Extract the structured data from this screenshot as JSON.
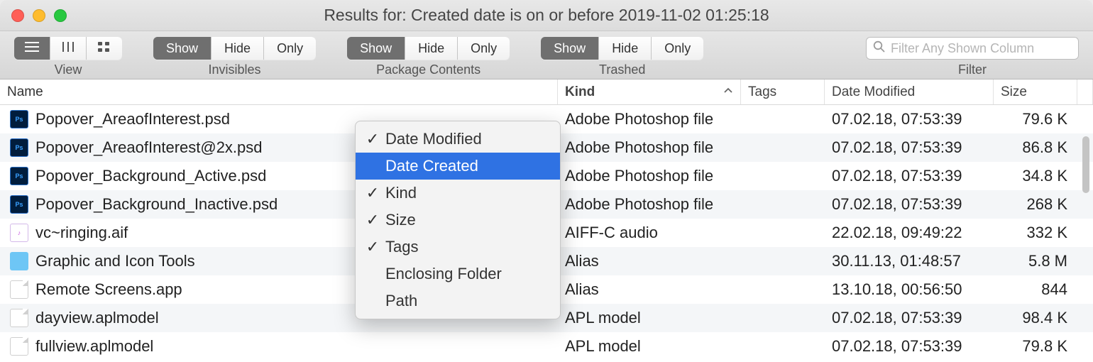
{
  "window": {
    "title": "Results for: Created date is on or before 2019-11-02 01:25:18"
  },
  "toolbar": {
    "view_label": "View",
    "invisibles_label": "Invisibles",
    "package_label": "Package Contents",
    "trashed_label": "Trashed",
    "filter_label": "Filter",
    "show": "Show",
    "hide": "Hide",
    "only": "Only",
    "search_placeholder": "Filter Any Shown Column"
  },
  "columns": {
    "name": "Name",
    "kind": "Kind",
    "tags": "Tags",
    "date": "Date Modified",
    "size": "Size"
  },
  "rows": [
    {
      "icon": "psd",
      "name": "Popover_AreaofInterest.psd",
      "kind": "Adobe Photoshop file",
      "date": "07.02.18, 07:53:39",
      "size": "79.6 K"
    },
    {
      "icon": "psd",
      "name": "Popover_AreaofInterest@2x.psd",
      "kind": "Adobe Photoshop file",
      "date": "07.02.18, 07:53:39",
      "size": "86.8 K"
    },
    {
      "icon": "psd",
      "name": "Popover_Background_Active.psd",
      "kind": "Adobe Photoshop file",
      "date": "07.02.18, 07:53:39",
      "size": "34.8 K"
    },
    {
      "icon": "psd",
      "name": "Popover_Background_Inactive.psd",
      "kind": "Adobe Photoshop file",
      "date": "07.02.18, 07:53:39",
      "size": "268 K"
    },
    {
      "icon": "aif",
      "name": "vc~ringing.aif",
      "kind": "AIFF-C audio",
      "date": "22.02.18, 09:49:22",
      "size": "332 K"
    },
    {
      "icon": "folder",
      "name": "Graphic and Icon Tools",
      "kind": "Alias",
      "date": "30.11.13, 01:48:57",
      "size": "5.8 M"
    },
    {
      "icon": "doc",
      "name": "Remote Screens.app",
      "kind": "Alias",
      "date": "13.10.18, 00:56:50",
      "size": "844"
    },
    {
      "icon": "doc",
      "name": "dayview.aplmodel",
      "kind": "APL model",
      "date": "07.02.18, 07:53:39",
      "size": "98.4 K"
    },
    {
      "icon": "doc",
      "name": "fullview.aplmodel",
      "kind": "APL model",
      "date": "07.02.18, 07:53:39",
      "size": "79.8 K"
    }
  ],
  "popup": {
    "items": [
      {
        "label": "Date Modified",
        "checked": true,
        "selected": false
      },
      {
        "label": "Date Created",
        "checked": false,
        "selected": true
      },
      {
        "label": "Kind",
        "checked": true,
        "selected": false
      },
      {
        "label": "Size",
        "checked": true,
        "selected": false
      },
      {
        "label": "Tags",
        "checked": true,
        "selected": false
      },
      {
        "label": "Enclosing Folder",
        "checked": false,
        "selected": false
      },
      {
        "label": "Path",
        "checked": false,
        "selected": false
      }
    ]
  }
}
